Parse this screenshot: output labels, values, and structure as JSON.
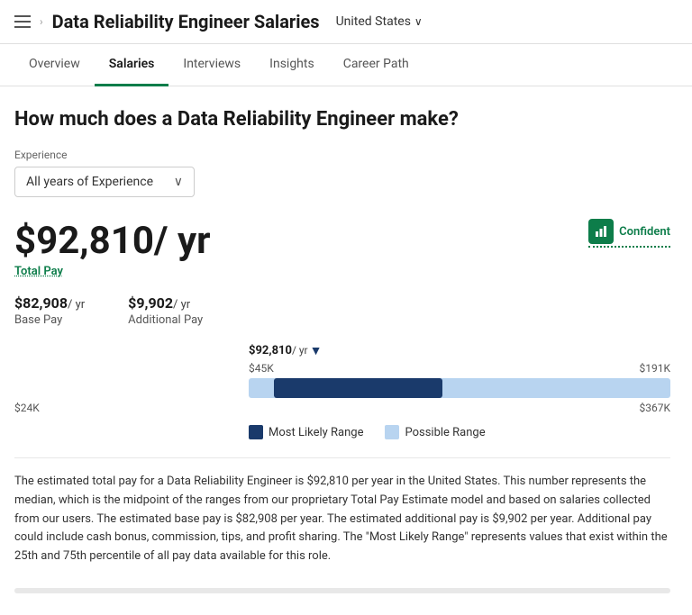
{
  "topBar": {
    "title": "Data Reliability Engineer Salaries",
    "location": "United States"
  },
  "navTabs": {
    "tabs": [
      {
        "id": "overview",
        "label": "Overview",
        "active": false
      },
      {
        "id": "salaries",
        "label": "Salaries",
        "active": true
      },
      {
        "id": "interviews",
        "label": "Interviews",
        "active": false
      },
      {
        "id": "insights",
        "label": "Insights",
        "active": false
      },
      {
        "id": "career-path",
        "label": "Career Path",
        "active": false
      }
    ]
  },
  "main": {
    "heading": "How much does a Data Reliability Engineer make?",
    "experienceLabel": "Experience",
    "experienceValue": "All years of Experience",
    "totalPayAmount": "$92,810",
    "totalPayUnit": "/ yr",
    "totalPayLabel": "Total Pay",
    "confidentLabel": "Confident",
    "basePay": "$82,908",
    "basePayUnit": "/ yr",
    "basePayLabel": "Base Pay",
    "additionalPay": "$9,902",
    "additionalPayUnit": "/ yr",
    "additionalPayLabel": "Additional Pay",
    "markerLabel": "$92,810",
    "markerUnit": "/ yr",
    "rangeLabel45": "$45K",
    "rangeLabel191": "$191K",
    "rangeLabel24": "$24K",
    "rangeLabel367": "$367K",
    "legend": {
      "mostLikely": "Most Likely Range",
      "possible": "Possible Range"
    },
    "description": "The estimated total pay for a Data Reliability Engineer is $92,810 per year in the United States. This number represents the median, which is the midpoint of the ranges from our proprietary Total Pay Estimate model and based on salaries collected from our users. The estimated base pay is $82,908 per year. The estimated additional pay is $9,902 per year. Additional pay could include cash bonus, commission, tips, and profit sharing. The \"Most Likely Range\" represents values that exist within the 25th and 75th percentile of all pay data available for this role."
  }
}
